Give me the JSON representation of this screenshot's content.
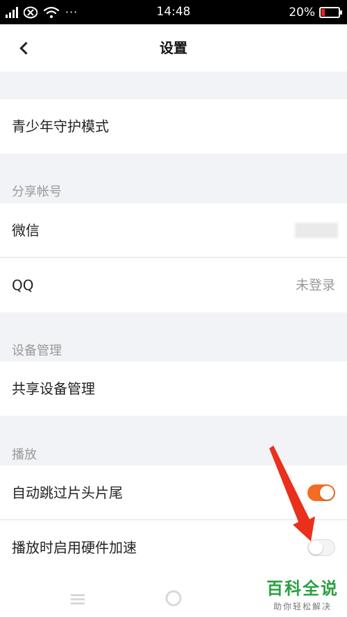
{
  "status_bar": {
    "time": "14:48",
    "battery": "20%",
    "battery_level": 0.2,
    "more": "···"
  },
  "nav": {
    "title": "设置"
  },
  "rows": {
    "youth_mode": "青少年守护模式",
    "wechat": "微信",
    "qq": "QQ",
    "qq_status": "未登录",
    "shared_device": "共享设备管理",
    "auto_skip": "自动跳过片头片尾",
    "hw_accel": "播放时启用硬件加速"
  },
  "sections": {
    "share_account": "分享帐号",
    "device_management": "设备管理",
    "playback": "播放"
  },
  "toggles": {
    "auto_skip_on": true,
    "hw_accel_on": false
  },
  "colors": {
    "accent": "#f26d21",
    "arrow": "#e8301c",
    "watermark": "#2aa040"
  },
  "watermark": {
    "title": "百科全说",
    "subtitle": "助你轻松解决"
  }
}
